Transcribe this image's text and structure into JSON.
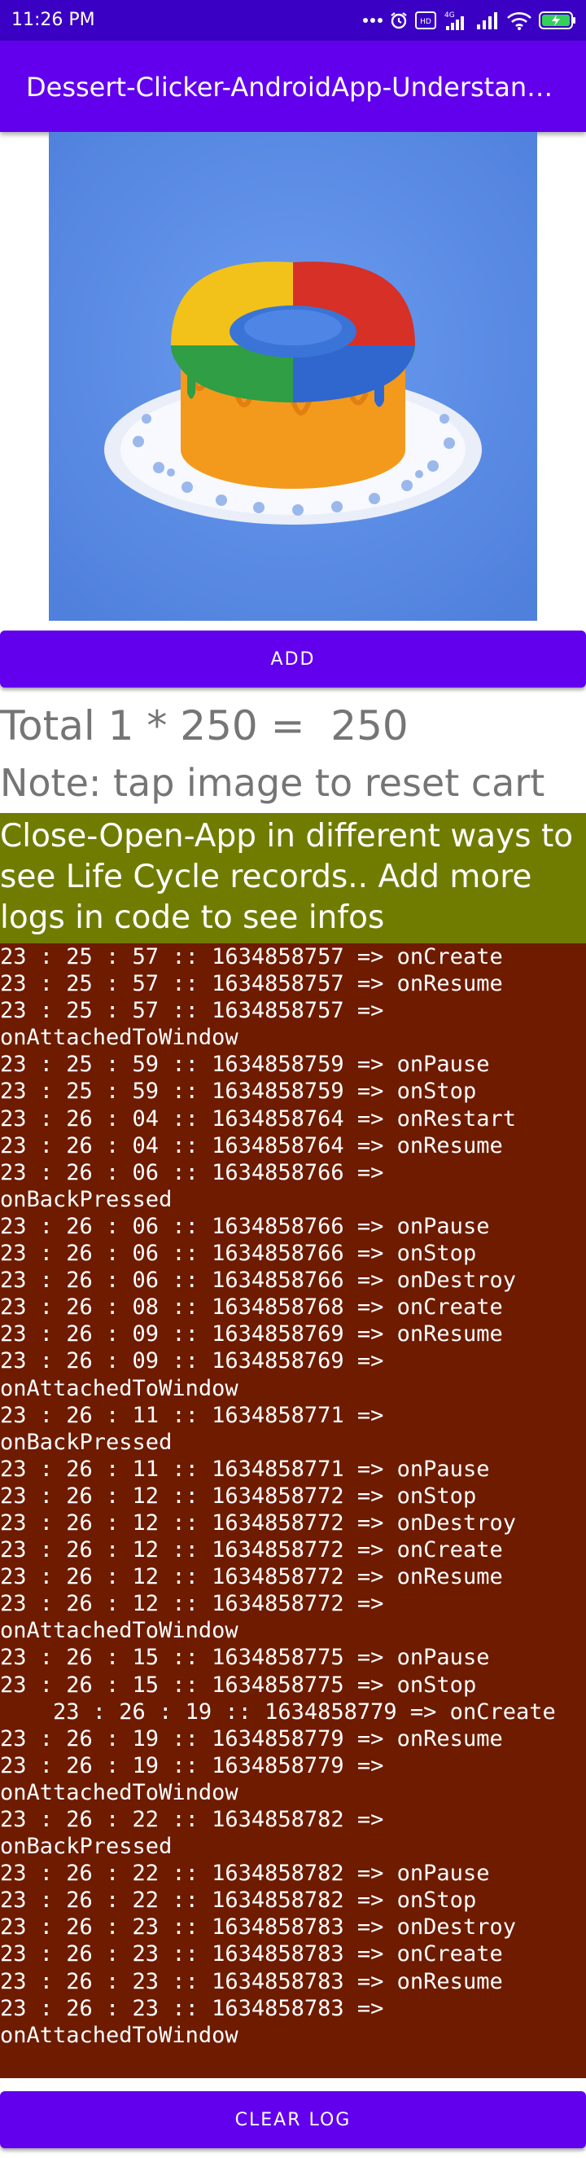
{
  "status_bar": {
    "time": "11:26 PM",
    "icons": [
      "more-icon",
      "alarm-icon",
      "volte-icon",
      "signal-4g-icon",
      "signal-icon",
      "wifi-icon",
      "battery-charging-icon"
    ]
  },
  "app_bar": {
    "title": "Dessert-Clicker-AndroidApp-Understand..."
  },
  "dessert": {
    "image_name": "cupcake-dessert-image",
    "colors": {
      "background": "#5a8de8",
      "cake": "#f39a1c",
      "red": "#d63027",
      "yellow": "#f2c21a",
      "green": "#2f9e44",
      "blue": "#2f67cf"
    }
  },
  "buttons": {
    "add_label": "ADD",
    "clear_label": "CLEAR LOG"
  },
  "summary": {
    "total": "Total 1 * 250 =  250",
    "note": "Note: tap image to reset cart"
  },
  "info": {
    "lines": [
      "Close-Open-App in different ways to",
      "see Life Cycle records.. Add more",
      "logs in code to see infos"
    ]
  },
  "log": {
    "lines": [
      "23 : 25 : 57 :: 1634858757 => onCreate",
      "23 : 25 : 57 :: 1634858757 => onResume",
      "23 : 25 : 57 :: 1634858757 =>",
      "onAttachedToWindow",
      "23 : 25 : 59 :: 1634858759 => onPause",
      "23 : 25 : 59 :: 1634858759 => onStop",
      "23 : 26 : 04 :: 1634858764 => onRestart",
      "23 : 26 : 04 :: 1634858764 => onResume",
      "23 : 26 : 06 :: 1634858766 =>",
      "onBackPressed",
      "23 : 26 : 06 :: 1634858766 => onPause",
      "23 : 26 : 06 :: 1634858766 => onStop",
      "23 : 26 : 06 :: 1634858766 => onDestroy",
      "23 : 26 : 08 :: 1634858768 => onCreate",
      "23 : 26 : 09 :: 1634858769 => onResume",
      "23 : 26 : 09 :: 1634858769 =>",
      "onAttachedToWindow",
      "23 : 26 : 11 :: 1634858771 =>",
      "onBackPressed",
      "23 : 26 : 11 :: 1634858771 => onPause",
      "23 : 26 : 12 :: 1634858772 => onStop",
      "23 : 26 : 12 :: 1634858772 => onDestroy",
      "23 : 26 : 12 :: 1634858772 => onCreate",
      "23 : 26 : 12 :: 1634858772 => onResume",
      "23 : 26 : 12 :: 1634858772 =>",
      "onAttachedToWindow",
      "23 : 26 : 15 :: 1634858775 => onPause",
      "23 : 26 : 15 :: 1634858775 => onStop",
      "    23 : 26 : 19 :: 1634858779 => onCreate",
      "23 : 26 : 19 :: 1634858779 => onResume",
      "23 : 26 : 19 :: 1634858779 =>",
      "onAttachedToWindow",
      "23 : 26 : 22 :: 1634858782 =>",
      "onBackPressed",
      "23 : 26 : 22 :: 1634858782 => onPause",
      "23 : 26 : 22 :: 1634858782 => onStop",
      "23 : 26 : 23 :: 1634858783 => onDestroy",
      "23 : 26 : 23 :: 1634858783 => onCreate",
      "23 : 26 : 23 :: 1634858783 => onResume",
      "23 : 26 : 23 :: 1634858783 =>",
      "onAttachedToWindow"
    ]
  },
  "colors": {
    "status_bar": "#3a00c4",
    "primary": "#6200ee",
    "info_bg": "#707c00",
    "log_bg": "#6e1b00",
    "secondary_text": "#757575"
  }
}
